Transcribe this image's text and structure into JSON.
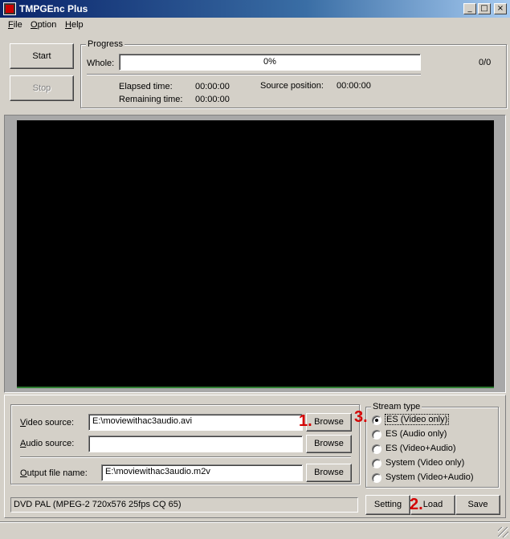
{
  "window": {
    "title": "TMPGEnc Plus",
    "minimize": "_",
    "maximize": "□",
    "close": "×"
  },
  "menu": [
    "File",
    "Option",
    "Help"
  ],
  "controls": {
    "start": "Start",
    "stop": "Stop"
  },
  "progress": {
    "group": "Progress",
    "whole_label": "Whole:",
    "percent": "0%",
    "percent_value": 0,
    "count": "0/0",
    "elapsed_label": "Elapsed time:",
    "elapsed": "00:00:00",
    "remaining_label": "Remaining time:",
    "remaining": "00:00:00",
    "source_pos_label": "Source position:",
    "source_pos": "00:00:00"
  },
  "sources": {
    "video_label": "Video source:",
    "video_value": "E:\\moviewithac3audio.avi",
    "audio_label": "Audio source:",
    "audio_value": "",
    "output_label": "Output file name:",
    "output_value": "E:\\moviewithac3audio.m2v",
    "browse": "Browse"
  },
  "stream_type": {
    "group": "Stream type",
    "options": [
      "ES (Video only)",
      "ES (Audio only)",
      "ES (Video+Audio)",
      "System (Video only)",
      "System (Video+Audio)"
    ],
    "selected": "ES (Video only)"
  },
  "profile": "DVD PAL (MPEG-2 720x576 25fps CQ 65)",
  "buttons": {
    "setting": "Setting",
    "load": "Load",
    "save": "Save"
  },
  "annotations": [
    "1.",
    "2.",
    "3."
  ],
  "colors": {
    "title_bar": "#0a246a",
    "face": "#d4d0c8",
    "annotation": "#d40000",
    "preview": "#000000"
  }
}
